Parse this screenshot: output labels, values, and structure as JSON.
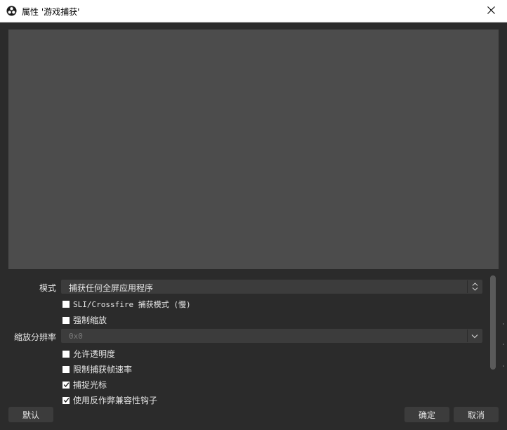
{
  "window": {
    "title": "属性 '游戏捕获'"
  },
  "form": {
    "mode_label": "模式",
    "mode_value": "捕获任何全屏应用程序",
    "sli_label": "SLI/Crossfire 捕获模式 (慢)",
    "sli_checked": false,
    "force_scale_label": "强制缩放",
    "force_scale_checked": false,
    "scale_res_label": "缩放分辨率",
    "scale_res_value": "0x0",
    "allow_transparency_label": "允许透明度",
    "allow_transparency_checked": false,
    "limit_fps_label": "限制捕获帧速率",
    "limit_fps_checked": false,
    "capture_cursor_label": "捕捉光标",
    "capture_cursor_checked": true,
    "anti_cheat_label": "使用反作弊兼容性钩子",
    "anti_cheat_checked": true
  },
  "buttons": {
    "defaults": "默认",
    "ok": "确定",
    "cancel": "取消"
  },
  "icons": {
    "app": "obs-logo-icon",
    "close": "close-icon",
    "updown": "updown-arrows-icon",
    "dropdown": "chevron-down-icon",
    "check": "checkmark-icon"
  }
}
